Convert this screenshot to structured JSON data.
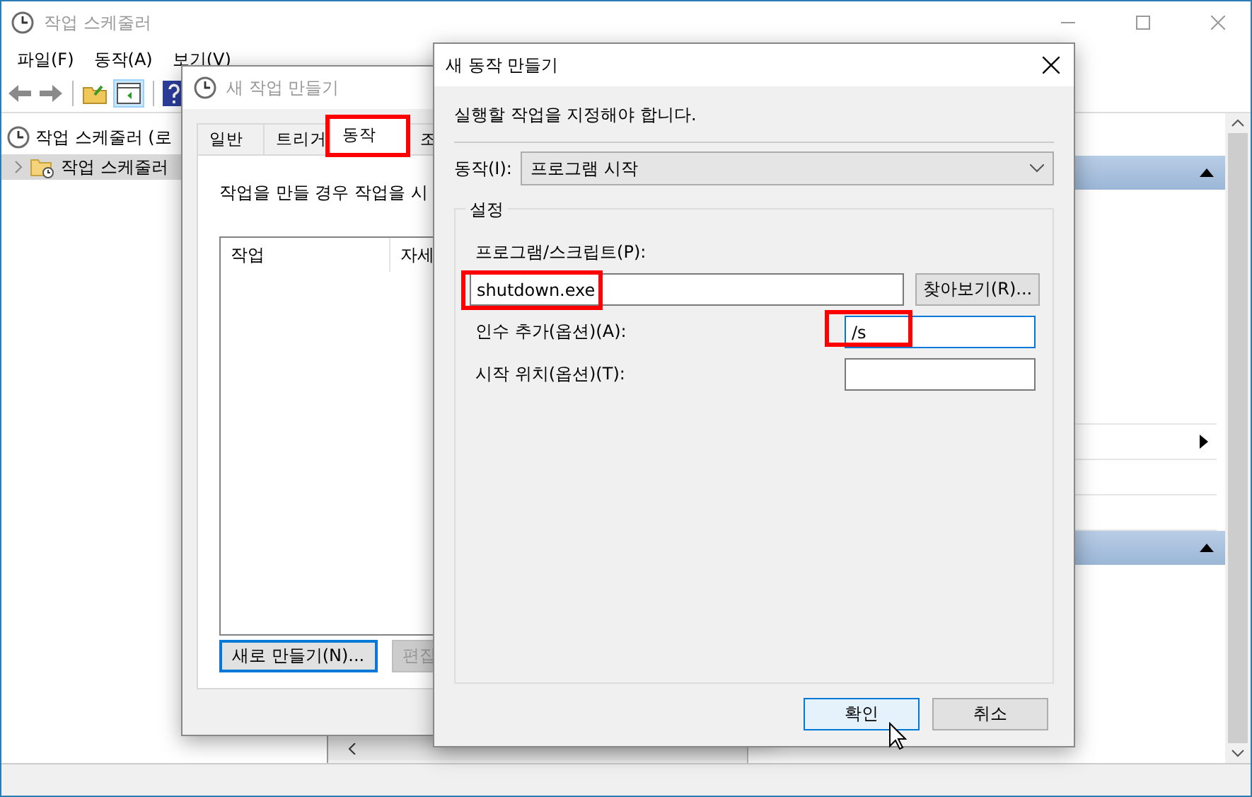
{
  "main_window": {
    "title": "작업 스케줄러",
    "menu": [
      "파일(F)",
      "동작(A)",
      "보기(V)"
    ],
    "tree": [
      {
        "label": "작업 스케줄러 (로",
        "selected": false,
        "children": [
          {
            "label": "작업 스케줄러",
            "selected": true,
            "expanded": false
          }
        ]
      }
    ]
  },
  "task_dialog": {
    "title": "새 작업 만들기",
    "tabs": [
      {
        "label": "일반",
        "selected": false,
        "highlighted": false
      },
      {
        "label": "트리거",
        "selected": false,
        "highlighted": false
      },
      {
        "label": "동작",
        "selected": true,
        "highlighted": true
      },
      {
        "label": "조",
        "selected": false,
        "highlighted": false
      }
    ],
    "description": "작업을 만들 경우 작업을 시",
    "columns": [
      "작업",
      "자세"
    ],
    "buttons": [
      {
        "label": "새로 만들기(N)...",
        "disabled": false
      },
      {
        "label": "편집",
        "disabled": true
      }
    ]
  },
  "action_dialog": {
    "title": "새 동작 만들기",
    "instruction": "실행할 작업을 지정해야 합니다.",
    "action_label": "동작(I):",
    "action_value": "프로그램 시작",
    "group_title": "설정",
    "program_label": "프로그램/스크립트(P):",
    "program": {
      "value": "shutdown.exe",
      "highlighted": true
    },
    "browse_button": "찾아보기(R)...",
    "fields": [
      {
        "label": "인수 추가(옵션)(A):",
        "value": "/s",
        "focused": true,
        "highlighted": true
      },
      {
        "label": "시작 위치(옵션)(T):",
        "focused": false,
        "highlighted": false
      }
    ],
    "buttons": [
      {
        "label": "확인",
        "default": true
      },
      {
        "label": "취소",
        "default": false
      }
    ]
  }
}
